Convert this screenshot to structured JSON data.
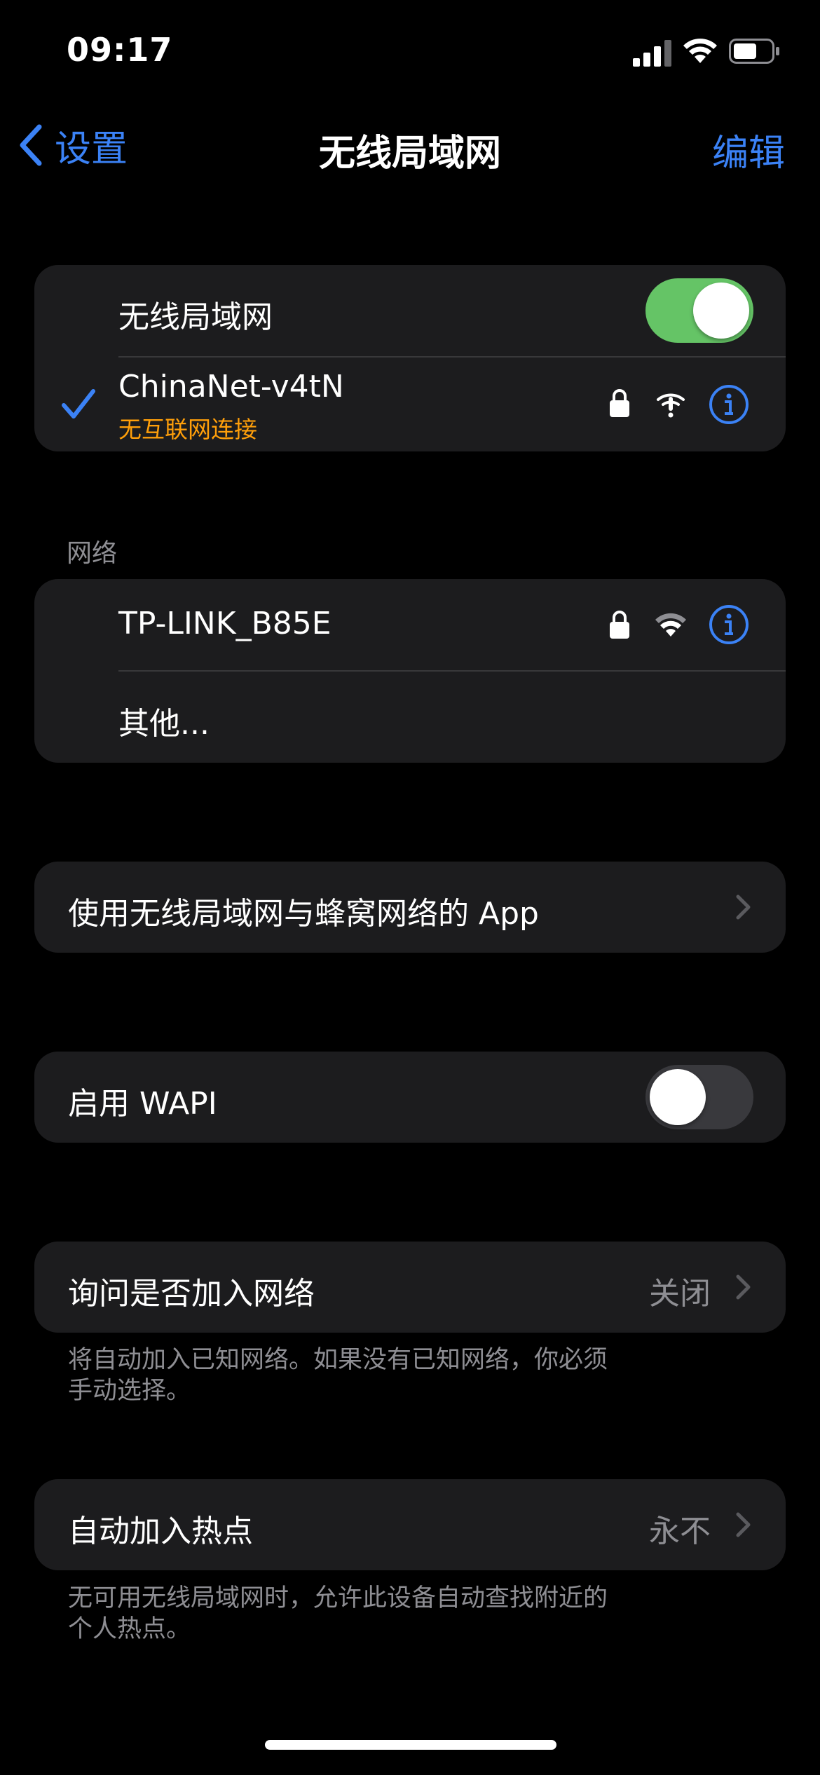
{
  "status_bar": {
    "time": "09:17"
  },
  "nav": {
    "back_label": "设置",
    "title": "无线局域网",
    "edit_label": "编辑"
  },
  "wifi_card": {
    "toggle_label": "无线局域网",
    "toggle_on": true,
    "connected": {
      "name": "ChinaNet-v4tN",
      "status": "无互联网连接",
      "status_color": "#ff9f0a"
    }
  },
  "networks": {
    "header": "网络",
    "items": [
      {
        "name": "TP-LINK_B85E"
      }
    ],
    "other_label": "其他..."
  },
  "apps_row": {
    "label": "使用无线局域网与蜂窝网络的 App"
  },
  "wapi_row": {
    "label": "启用 WAPI",
    "toggle_on": false
  },
  "ask_join": {
    "label": "询问是否加入网络",
    "value": "关闭",
    "footnote": "将自动加入已知网络。如果没有已知网络，你必须\n手动选择。"
  },
  "hotspot": {
    "label": "自动加入热点",
    "value": "永不",
    "footnote": "无可用无线局域网时，允许此设备自动查找附近的\n个人热点。"
  },
  "colors": {
    "accent": "#3b82f6",
    "toggle_on": "#65c466",
    "toggle_off": "#39393d",
    "card_bg": "#1c1c1e"
  }
}
